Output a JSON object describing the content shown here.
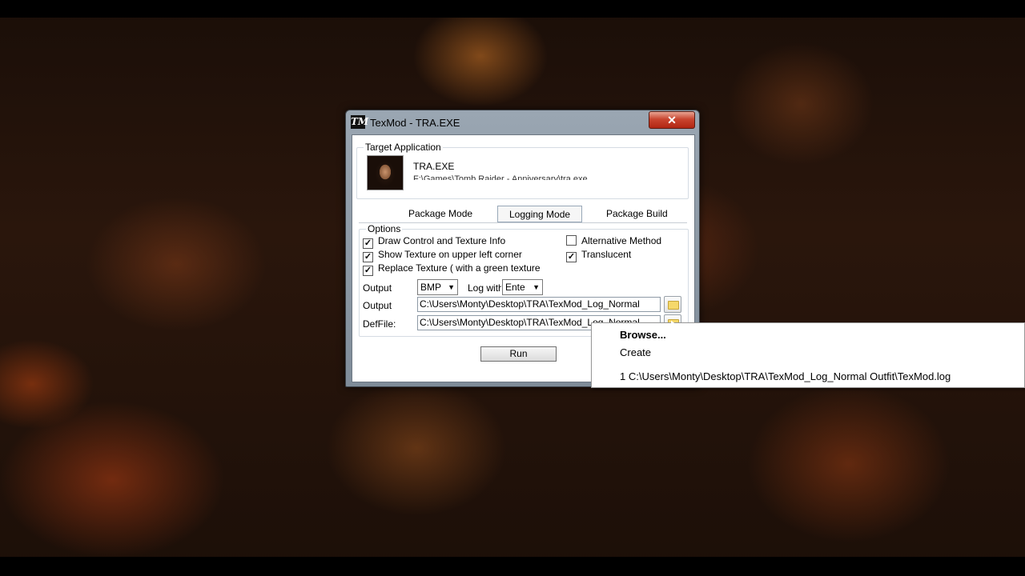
{
  "window": {
    "title": "TexMod - TRA.EXE",
    "icon_text": "TM",
    "close_label": "✕"
  },
  "target": {
    "group_title": "Target Application",
    "name": "TRA.EXE",
    "path": "F:\\Games\\Tomb Raider - Anniversary\\tra.exe"
  },
  "tabs": [
    {
      "label": "Package Mode"
    },
    {
      "label": "Logging Mode",
      "active": true
    },
    {
      "label": "Package Build"
    }
  ],
  "options": {
    "group_title": "Options",
    "checkboxes": [
      {
        "label": "Draw Control and Texture Info",
        "checked": true
      },
      {
        "label": "Show Texture on upper left corner",
        "checked": true
      },
      {
        "label": "Replace Texture ( with a green texture",
        "checked": true
      },
      {
        "label": "Alternative Method",
        "checked": false
      },
      {
        "label": "Translucent",
        "checked": true
      }
    ],
    "output_label": "Output",
    "format_value": "BMP",
    "log_with_label": "Log with",
    "log_with_value": "Ente",
    "output_folder_label": "Output",
    "output_folder_value": "C:\\Users\\Monty\\Desktop\\TRA\\TexMod_Log_Normal",
    "deffile_label": "DefFile:",
    "deffile_value": "C:\\Users\\Monty\\Desktop\\TRA\\TexMod_Log_Normal"
  },
  "run_label": "Run",
  "context_menu": {
    "items": [
      {
        "label": "Browse..."
      },
      {
        "label": "Create"
      },
      {
        "label": "1 C:\\Users\\Monty\\Desktop\\TRA\\TexMod_Log_Normal Outfit\\TexMod.log"
      }
    ]
  }
}
